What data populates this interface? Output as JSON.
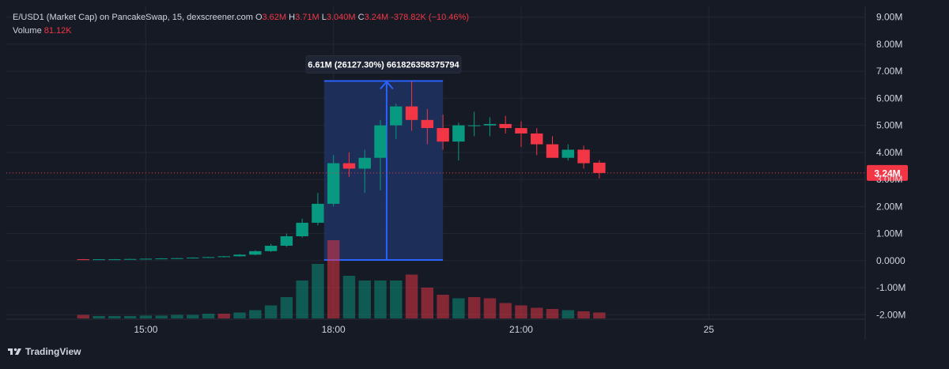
{
  "header": {
    "symbol_line": "E/USD1 (Market Cap) on PancakeSwap, 15, dexscreener.com",
    "o_label": "O",
    "o_value": "3.62M",
    "h_label": "H",
    "h_value": "3.71M",
    "l_label": "L",
    "l_value": "3.040M",
    "c_label": "C",
    "c_value": "3.24M",
    "change": "-378.82K (−10.46%)",
    "volume_label": "Volume",
    "volume_value": "81.12K"
  },
  "brand": {
    "name": "TradingView",
    "icon": "tradingview-logo-icon"
  },
  "measure": {
    "label": "6.61M (26127.30%) 661826358375794",
    "start_time": 17.85,
    "end_time": 19.75,
    "low": 0.025,
    "high": 6.64
  },
  "colors": {
    "background": "#161a25",
    "grid": "#232733",
    "up": "#089981",
    "down": "#f23645",
    "axis_text": "#d1d4dc",
    "measure_line": "#2962ff",
    "measure_fill": "#1e3361",
    "price_tag": "#f23645"
  },
  "chart_data": {
    "type": "candlestick",
    "y_axis": {
      "range": [
        -2.0,
        9.0
      ],
      "unit": "M",
      "ticks": [
        "9.00M",
        "8.00M",
        "7.00M",
        "6.00M",
        "5.00M",
        "4.00M",
        "3.00M",
        "2.00M",
        "1.00M",
        "0.0000",
        "-1.00M",
        "-2.00M"
      ],
      "tick_values": [
        9,
        8,
        7,
        6,
        5,
        4,
        3,
        2,
        1,
        0,
        -1,
        -2
      ]
    },
    "x_axis": {
      "range_hours": [
        12.77,
        26.5
      ],
      "ticks": [
        {
          "label": "15:00",
          "t": 15
        },
        {
          "label": "18:00",
          "t": 18
        },
        {
          "label": "21:00",
          "t": 21
        },
        {
          "label": "25",
          "t": 24
        }
      ]
    },
    "last_price": {
      "value": 3.24,
      "label": "3.24M"
    },
    "candles": [
      {
        "t": 14.0,
        "o": 0.05,
        "h": 0.06,
        "l": 0.03,
        "c": 0.04
      },
      {
        "t": 14.25,
        "o": 0.04,
        "h": 0.05,
        "l": 0.03,
        "c": 0.05
      },
      {
        "t": 14.5,
        "o": 0.05,
        "h": 0.06,
        "l": 0.04,
        "c": 0.05
      },
      {
        "t": 14.75,
        "o": 0.05,
        "h": 0.07,
        "l": 0.04,
        "c": 0.06
      },
      {
        "t": 15.0,
        "o": 0.06,
        "h": 0.07,
        "l": 0.05,
        "c": 0.07
      },
      {
        "t": 15.25,
        "o": 0.07,
        "h": 0.09,
        "l": 0.06,
        "c": 0.08
      },
      {
        "t": 15.5,
        "o": 0.08,
        "h": 0.1,
        "l": 0.07,
        "c": 0.09
      },
      {
        "t": 15.75,
        "o": 0.09,
        "h": 0.12,
        "l": 0.08,
        "c": 0.11
      },
      {
        "t": 16.0,
        "o": 0.11,
        "h": 0.14,
        "l": 0.1,
        "c": 0.13
      },
      {
        "t": 16.25,
        "o": 0.13,
        "h": 0.17,
        "l": 0.12,
        "c": 0.16
      },
      {
        "t": 16.5,
        "o": 0.16,
        "h": 0.24,
        "l": 0.15,
        "c": 0.22
      },
      {
        "t": 16.75,
        "o": 0.22,
        "h": 0.38,
        "l": 0.2,
        "c": 0.35
      },
      {
        "t": 17.0,
        "o": 0.35,
        "h": 0.62,
        "l": 0.32,
        "c": 0.55
      },
      {
        "t": 17.25,
        "o": 0.55,
        "h": 1.0,
        "l": 0.5,
        "c": 0.9
      },
      {
        "t": 17.5,
        "o": 0.9,
        "h": 1.55,
        "l": 0.85,
        "c": 1.4
      },
      {
        "t": 17.75,
        "o": 1.4,
        "h": 2.5,
        "l": 1.3,
        "c": 2.1
      },
      {
        "t": 18.0,
        "o": 2.1,
        "h": 3.9,
        "l": 2.0,
        "c": 3.6
      },
      {
        "t": 18.25,
        "o": 3.6,
        "h": 4.0,
        "l": 3.1,
        "c": 3.4
      },
      {
        "t": 18.5,
        "o": 3.4,
        "h": 4.1,
        "l": 2.5,
        "c": 3.8
      },
      {
        "t": 18.75,
        "o": 3.8,
        "h": 5.2,
        "l": 2.6,
        "c": 5.0
      },
      {
        "t": 19.0,
        "o": 5.0,
        "h": 5.8,
        "l": 4.5,
        "c": 5.7
      },
      {
        "t": 19.25,
        "o": 5.7,
        "h": 6.64,
        "l": 4.8,
        "c": 5.2
      },
      {
        "t": 19.5,
        "o": 5.2,
        "h": 5.6,
        "l": 4.3,
        "c": 4.9
      },
      {
        "t": 19.75,
        "o": 4.9,
        "h": 5.4,
        "l": 4.1,
        "c": 4.4
      },
      {
        "t": 20.0,
        "o": 4.4,
        "h": 5.1,
        "l": 3.7,
        "c": 5.0
      },
      {
        "t": 20.25,
        "o": 5.0,
        "h": 5.5,
        "l": 4.6,
        "c": 5.0
      },
      {
        "t": 20.5,
        "o": 5.0,
        "h": 5.3,
        "l": 4.6,
        "c": 5.05
      },
      {
        "t": 20.75,
        "o": 5.05,
        "h": 5.35,
        "l": 4.7,
        "c": 4.9
      },
      {
        "t": 21.0,
        "o": 4.9,
        "h": 5.15,
        "l": 4.2,
        "c": 4.7
      },
      {
        "t": 21.25,
        "o": 4.7,
        "h": 4.9,
        "l": 3.9,
        "c": 4.3
      },
      {
        "t": 21.5,
        "o": 4.3,
        "h": 4.6,
        "l": 3.8,
        "c": 3.8
      },
      {
        "t": 21.75,
        "o": 3.8,
        "h": 4.3,
        "l": 3.7,
        "c": 4.1
      },
      {
        "t": 22.0,
        "o": 4.1,
        "h": 4.25,
        "l": 3.4,
        "c": 3.6
      },
      {
        "t": 22.25,
        "o": 3.62,
        "h": 3.71,
        "l": 3.04,
        "c": 3.24
      }
    ],
    "volume": [
      {
        "t": 14.0,
        "v": 0.15,
        "dir": "down"
      },
      {
        "t": 14.25,
        "v": 0.1,
        "dir": "up"
      },
      {
        "t": 14.5,
        "v": 0.1,
        "dir": "up"
      },
      {
        "t": 14.75,
        "v": 0.1,
        "dir": "up"
      },
      {
        "t": 15.0,
        "v": 0.12,
        "dir": "up"
      },
      {
        "t": 15.25,
        "v": 0.12,
        "dir": "up"
      },
      {
        "t": 15.5,
        "v": 0.15,
        "dir": "up"
      },
      {
        "t": 15.75,
        "v": 0.15,
        "dir": "up"
      },
      {
        "t": 16.0,
        "v": 0.2,
        "dir": "up"
      },
      {
        "t": 16.25,
        "v": 0.2,
        "dir": "down"
      },
      {
        "t": 16.5,
        "v": 0.25,
        "dir": "up"
      },
      {
        "t": 16.75,
        "v": 0.35,
        "dir": "up"
      },
      {
        "t": 17.0,
        "v": 0.55,
        "dir": "up"
      },
      {
        "t": 17.25,
        "v": 0.9,
        "dir": "up"
      },
      {
        "t": 17.5,
        "v": 1.6,
        "dir": "up"
      },
      {
        "t": 17.75,
        "v": 2.3,
        "dir": "up"
      },
      {
        "t": 18.0,
        "v": 3.3,
        "dir": "down"
      },
      {
        "t": 18.25,
        "v": 1.8,
        "dir": "up"
      },
      {
        "t": 18.5,
        "v": 1.6,
        "dir": "up"
      },
      {
        "t": 18.75,
        "v": 1.6,
        "dir": "up"
      },
      {
        "t": 19.0,
        "v": 1.6,
        "dir": "up"
      },
      {
        "t": 19.25,
        "v": 1.85,
        "dir": "down"
      },
      {
        "t": 19.5,
        "v": 1.3,
        "dir": "down"
      },
      {
        "t": 19.75,
        "v": 1.0,
        "dir": "down"
      },
      {
        "t": 20.0,
        "v": 0.85,
        "dir": "up"
      },
      {
        "t": 20.25,
        "v": 0.9,
        "dir": "down"
      },
      {
        "t": 20.5,
        "v": 0.85,
        "dir": "down"
      },
      {
        "t": 20.75,
        "v": 0.65,
        "dir": "down"
      },
      {
        "t": 21.0,
        "v": 0.55,
        "dir": "down"
      },
      {
        "t": 21.25,
        "v": 0.45,
        "dir": "down"
      },
      {
        "t": 21.5,
        "v": 0.4,
        "dir": "down"
      },
      {
        "t": 21.75,
        "v": 0.35,
        "dir": "up"
      },
      {
        "t": 22.0,
        "v": 0.3,
        "dir": "down"
      },
      {
        "t": 22.25,
        "v": 0.25,
        "dir": "down"
      }
    ]
  }
}
